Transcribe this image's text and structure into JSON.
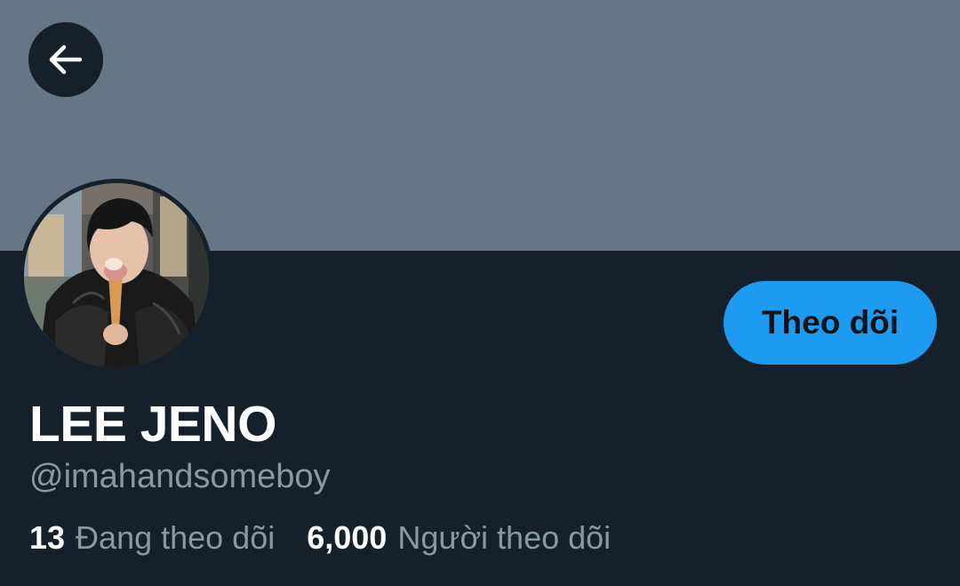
{
  "header": {
    "back_icon": "arrow-left-icon",
    "banner_color": "#657786"
  },
  "profile": {
    "display_name": "LEE JENO",
    "handle": "@imahandsomeboy",
    "avatar": "profile-photo"
  },
  "actions": {
    "follow_label": "Theo dõi",
    "follow_color": "#1d9bf0"
  },
  "stats": {
    "following_count": "13",
    "following_label": "Đang theo dõi",
    "followers_count": "6,000",
    "followers_label": "Người theo dõi"
  },
  "theme": {
    "background": "#15202b",
    "primary_text": "#ffffff",
    "secondary_text": "#8899a6"
  }
}
